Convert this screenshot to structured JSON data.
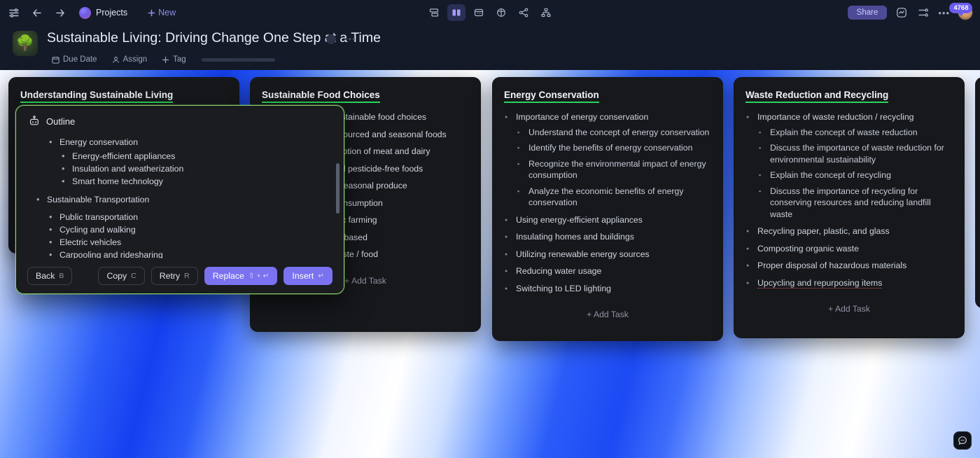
{
  "topnav": {
    "menu_icon": "menu-icon",
    "back_icon": "back-arrow-icon",
    "forward_icon": "forward-arrow-icon",
    "project_label": "Projects",
    "new_label": "New",
    "views": [
      {
        "name": "view-list",
        "icon": "list-view-icon",
        "active": false
      },
      {
        "name": "view-board",
        "icon": "board-view-icon",
        "active": true
      },
      {
        "name": "view-calendar",
        "icon": "calendar-view-icon",
        "active": false
      },
      {
        "name": "view-table",
        "icon": "table-view-icon",
        "active": false
      },
      {
        "name": "view-share-graph",
        "icon": "share-nodes-icon",
        "active": false
      },
      {
        "name": "view-org-chart",
        "icon": "org-chart-icon",
        "active": false
      }
    ],
    "share_label": "Share",
    "notification_count": "4768",
    "dots_label": "•••",
    "accent_purple": "#6c5cf0"
  },
  "header": {
    "emoji": "🌳",
    "title": "Sustainable Living: Driving Change One Step at a Time",
    "meta": [
      {
        "name": "due-date",
        "icon": "calendar-icon",
        "label": "Due Date"
      },
      {
        "name": "assign",
        "icon": "person-icon",
        "label": "Assign"
      },
      {
        "name": "tag",
        "icon": "plus-icon",
        "label": "Tag"
      }
    ]
  },
  "board": {
    "add_task_label": "Add Task",
    "underline_color": "#2bd45a",
    "columns": [
      {
        "title": "Understanding Sustainable Living",
        "items": []
      },
      {
        "title": "Sustainable Food Choices",
        "items": [
          {
            "text": "Understanding sustainable food choices",
            "visible_fragment": "ainable food choices",
            "children": []
          },
          {
            "text": "Choosing locally sourced and seasonal foods",
            "visible_fragment": "sourced and seasonal",
            "children": []
          },
          {
            "text": "Reducing consumption of meat and dairy",
            "visible_fragment": "ption of meat and dairy",
            "children": []
          },
          {
            "text": "Eating organic and pesticide-free foods",
            "visible_fragment": "and pesticide-free",
            "children": []
          },
          {
            "text": "Buying local and seasonal produce",
            "visible_fragment": "asonal produce",
            "children": []
          },
          {
            "text": "Reducing meat consumption",
            "visible_fragment": "sumption",
            "children": []
          },
          {
            "text": "Supporting organic farming",
            "visible_fragment": "farming",
            "children": []
          },
          {
            "text": "Eating more plant-based",
            "visible_fragment": "e",
            "children": []
          },
          {
            "text": "Reducing food waste / food",
            "visible_fragment": "ood",
            "children": []
          }
        ]
      },
      {
        "title": "Energy Conservation",
        "items": [
          {
            "text": "Importance of energy conservation",
            "children": [
              "Understand the concept of energy conservation",
              "Identify the benefits of energy conservation",
              "Recognize the environmental impact of energy consumption",
              "Analyze the economic benefits of energy conservation"
            ]
          },
          {
            "text": "Using energy-efficient appliances",
            "children": []
          },
          {
            "text": "Insulating homes and buildings",
            "children": []
          },
          {
            "text": "Utilizing renewable energy sources",
            "children": []
          },
          {
            "text": "Reducing water usage",
            "children": []
          },
          {
            "text": "Switching to LED lighting",
            "children": []
          }
        ]
      },
      {
        "title": "Waste Reduction and Recycling",
        "items": [
          {
            "text": "Importance of waste reduction / recycling",
            "children": [
              "Explain the concept of waste reduction",
              "Discuss the importance of waste reduction for environmental sustainability",
              "Explain the concept of recycling",
              "Discuss the importance of recycling for conserving resources and reducing landfill waste"
            ]
          },
          {
            "text": "Recycling paper, plastic, and glass",
            "children": []
          },
          {
            "text": "Composting organic waste",
            "children": []
          },
          {
            "text": "Proper disposal of hazardous materials",
            "children": []
          },
          {
            "text": "Upcycling and repurposing items",
            "children": []
          }
        ]
      }
    ]
  },
  "popup": {
    "icon": "ai-robot-icon",
    "title": "Outline",
    "groups": [
      {
        "heading": "Energy conservation",
        "children": [
          "Energy-efficient appliances",
          "Insulation and weatherization",
          "Smart home technology"
        ]
      },
      {
        "heading": "Sustainable Transportation",
        "children": [
          "Public transportation",
          "Cycling and walking",
          "Electric vehicles",
          "Carpooling and ridesharing"
        ]
      }
    ],
    "buttons": [
      {
        "name": "back-button",
        "label": "Back",
        "key": "B",
        "primary": false
      },
      {
        "name": "copy-button",
        "label": "Copy",
        "key": "C",
        "primary": false
      },
      {
        "name": "retry-button",
        "label": "Retry",
        "key": "R",
        "primary": false
      },
      {
        "name": "replace-button",
        "label": "Replace",
        "key": "⇧ + ↵",
        "primary": true
      },
      {
        "name": "insert-button",
        "label": "Insert",
        "key": "↵",
        "primary": true
      }
    ]
  },
  "chat": {
    "icon": "chat-bubble-icon"
  }
}
